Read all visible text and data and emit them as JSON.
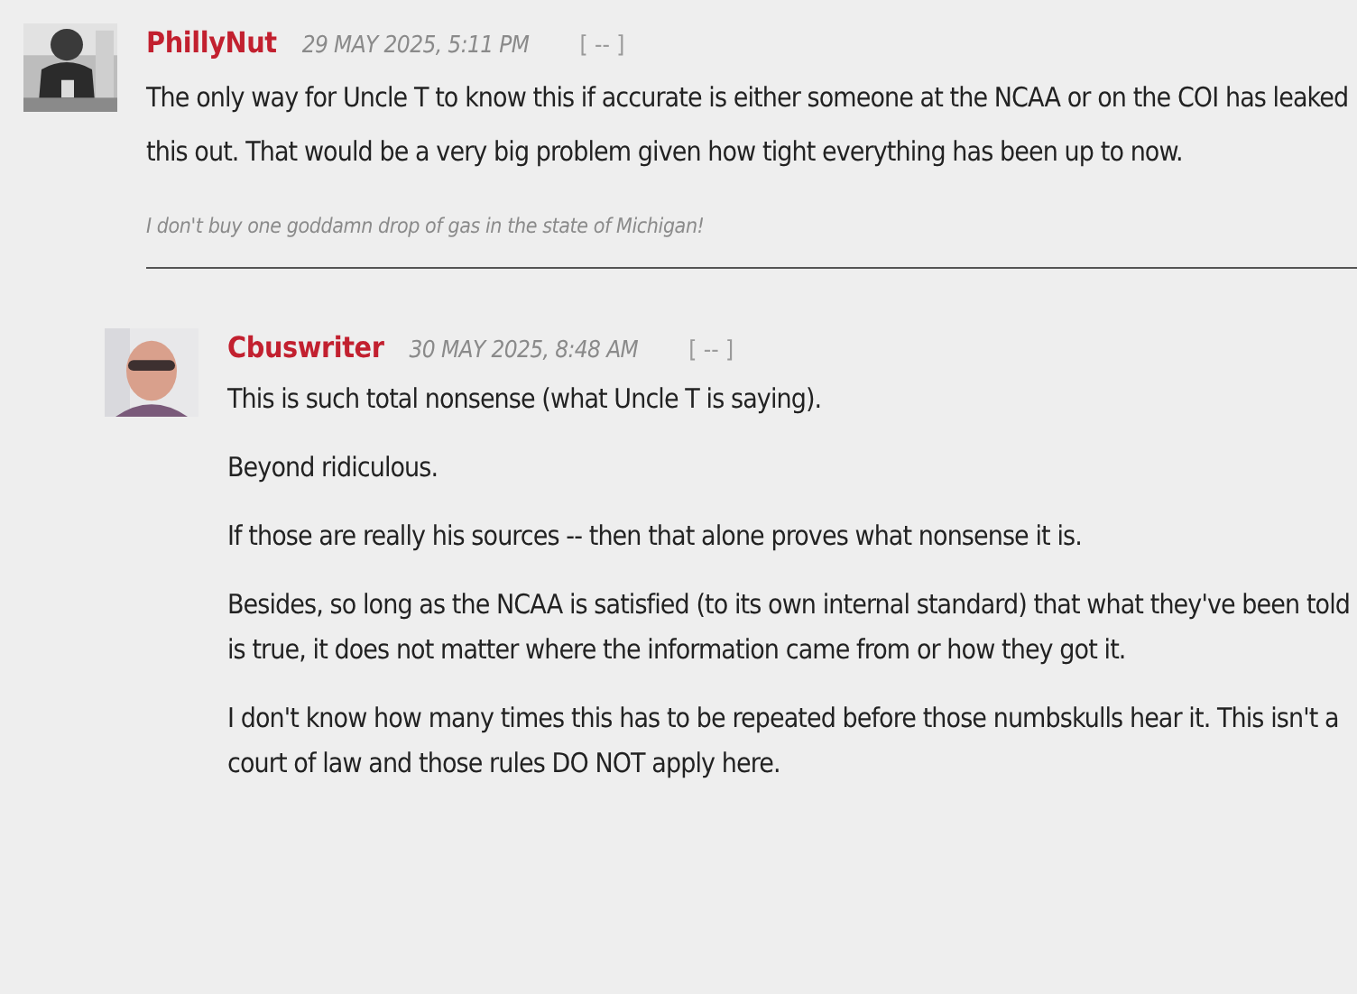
{
  "comments": [
    {
      "author": "PhillyNut",
      "time": "29 MAY 2025, 5:11 PM",
      "collapse": "[ -- ]",
      "paragraphs": [
        "The only way for Uncle T to know this if accurate is either someone at the NCAA or on the COI has leaked this out. That would be a very big problem given how tight everything has been up to now."
      ],
      "signature": "I don't buy one goddamn drop of gas in the state of Michigan!",
      "replies": [
        {
          "author": "Cbuswriter",
          "time": "30 MAY 2025, 8:48 AM",
          "collapse": "[ -- ]",
          "paragraphs": [
            "This is such total nonsense (what Uncle T is saying).",
            "Beyond ridiculous.",
            "If those are really his sources -- then that alone proves what nonsense it is.",
            "Besides, so long as the NCAA is satisfied (to its own internal standard) that what they've been told is true, it does not matter where the information came from or how they got it.",
            "I don't know how many times this has to be repeated before those numbskulls hear it. This isn't a court of law and those rules DO NOT apply here."
          ]
        }
      ]
    }
  ]
}
